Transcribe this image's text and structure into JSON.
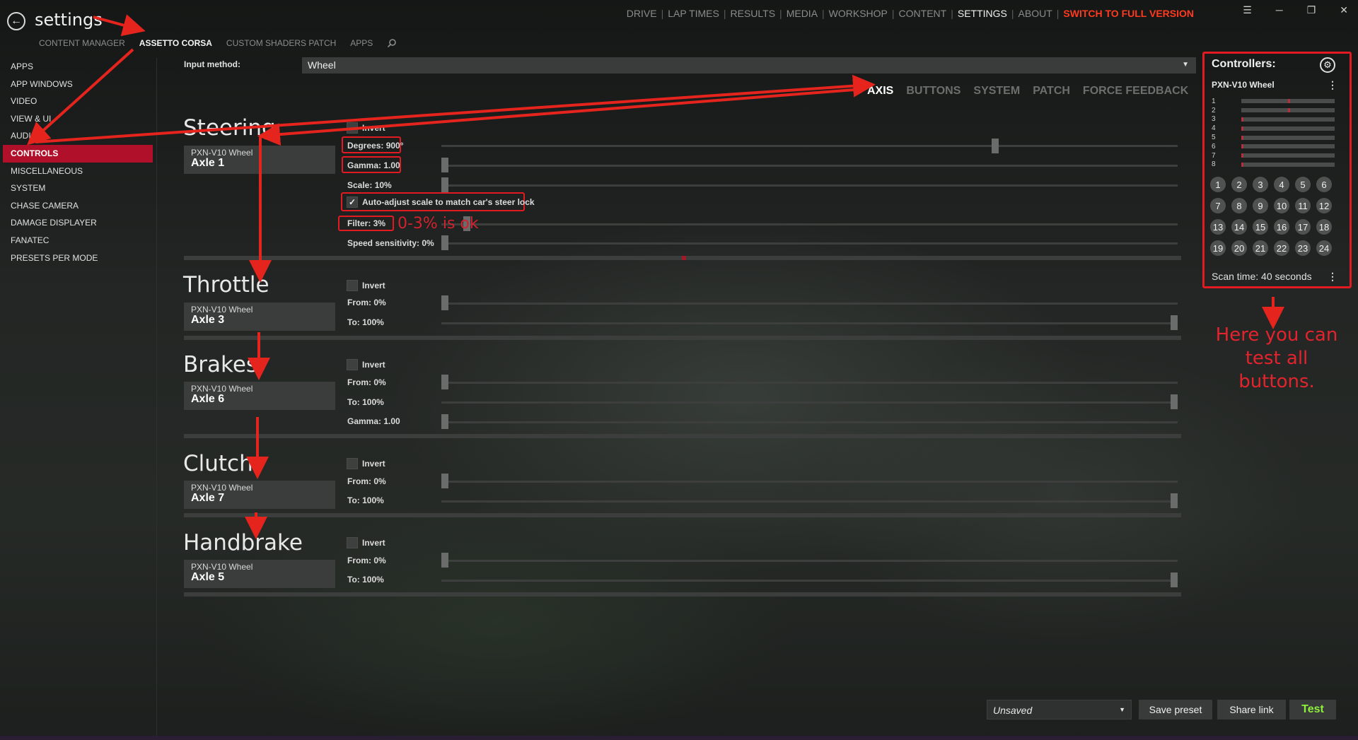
{
  "window": {
    "title": "settings",
    "top_nav": [
      "DRIVE",
      "LAP TIMES",
      "RESULTS",
      "MEDIA",
      "WORKSHOP",
      "CONTENT",
      "SETTINGS",
      "ABOUT"
    ],
    "full_version": "SWITCH TO FULL VERSION",
    "controls": [
      "☰",
      "─",
      "❐",
      "✕"
    ]
  },
  "subtabs": [
    "CONTENT MANAGER",
    "ASSETTO CORSA",
    "CUSTOM SHADERS PATCH",
    "APPS"
  ],
  "sidebar": [
    "APPS",
    "APP WINDOWS",
    "VIDEO",
    "VIEW & UI",
    "AUDIO",
    "CONTROLS",
    "MISCELLANEOUS",
    "SYSTEM",
    "CHASE CAMERA",
    "DAMAGE DISPLAYER",
    "FANATEC",
    "PRESETS PER MODE"
  ],
  "input": {
    "label": "Input method:",
    "value": "Wheel"
  },
  "axis_tabs": [
    "AXIS",
    "BUTTONS",
    "SYSTEM",
    "PATCH",
    "FORCE FEEDBACK"
  ],
  "steering": {
    "title": "Steering",
    "device": "PXN-V10 Wheel",
    "axle": "Axle 1",
    "invert": "Invert",
    "degrees": "Degrees: 900°",
    "degrees_level": 0.755,
    "gamma": "Gamma: 1.00",
    "gamma_level": 0,
    "scale": "Scale: 10%",
    "scale_level": 0,
    "auto_adjust": "Auto-adjust scale to match car's steer lock",
    "filter": "Filter: 3%",
    "filter_level": 0.03,
    "speed_sensitivity": "Speed sensitivity: 0%",
    "speed_level": 0,
    "annotation": "0-3% is ok"
  },
  "sections": [
    {
      "title": "Throttle",
      "device": "PXN-V10 Wheel",
      "axle": "Axle 3",
      "invert": "Invert",
      "rows": [
        {
          "label": "From: 0%",
          "level": 0
        },
        {
          "label": "To: 100%",
          "level": 1
        }
      ]
    },
    {
      "title": "Brakes",
      "device": "PXN-V10 Wheel",
      "axle": "Axle 6",
      "invert": "Invert",
      "rows": [
        {
          "label": "From: 0%",
          "level": 0
        },
        {
          "label": "To: 100%",
          "level": 1
        },
        {
          "label": "Gamma: 1.00",
          "level": 0
        }
      ]
    },
    {
      "title": "Clutch",
      "device": "PXN-V10 Wheel",
      "axle": "Axle 7",
      "invert": "Invert",
      "rows": [
        {
          "label": "From: 0%",
          "level": 0
        },
        {
          "label": "To: 100%",
          "level": 1
        }
      ]
    },
    {
      "title": "Handbrake",
      "device": "PXN-V10 Wheel",
      "axle": "Axle 5",
      "invert": "Invert",
      "rows": [
        {
          "label": "From: 0%",
          "level": 0
        },
        {
          "label": "To: 100%",
          "level": 1
        }
      ]
    }
  ],
  "controllers": {
    "title": "Controllers:",
    "device": "PXN-V10 Wheel",
    "axes": [
      "1",
      "2",
      "3",
      "4",
      "5",
      "6",
      "7",
      "8"
    ],
    "buttons": [
      "1",
      "2",
      "3",
      "4",
      "5",
      "6",
      "7",
      "8",
      "9",
      "10",
      "11",
      "12",
      "13",
      "14",
      "15",
      "16",
      "17",
      "18",
      "19",
      "20",
      "21",
      "22",
      "23",
      "24"
    ],
    "scan_time": "Scan time: 40 seconds",
    "annotation": "Here you can test all buttons."
  },
  "bottom": {
    "preset": "Unsaved",
    "save_preset": "Save preset",
    "share_link": "Share link",
    "test": "Test"
  },
  "colors": {
    "accent": "#b0102a",
    "annotation_red": "#e21a22",
    "full_version": "#ff3a1f",
    "test_green": "#8ef03a"
  }
}
